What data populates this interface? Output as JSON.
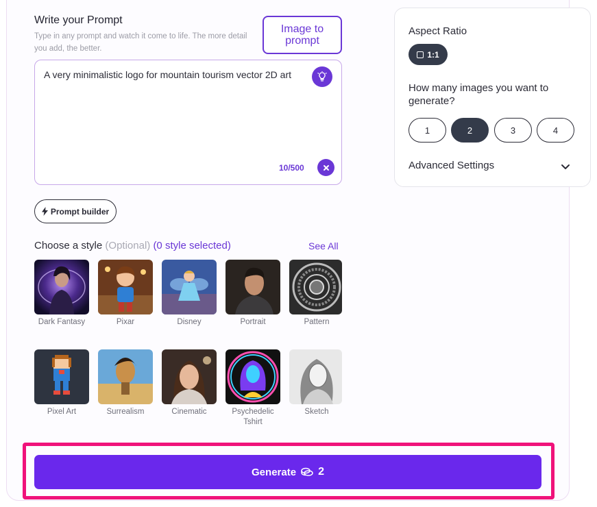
{
  "prompt": {
    "title": "Write your Prompt",
    "subtitle": "Type in any prompt and watch it come to life. The more detail you add, the better.",
    "image_to_prompt_label": "Image to prompt",
    "value": "A very minimalistic logo for mountain tourism vector 2D art",
    "char_count": "10/500",
    "builder_label": "Prompt builder"
  },
  "styles": {
    "heading": "Choose a style",
    "optional": "(Optional)",
    "selected": "(0 style selected)",
    "see_all": "See All",
    "items": [
      {
        "label": "Dark Fantasy"
      },
      {
        "label": "Pixar"
      },
      {
        "label": "Disney"
      },
      {
        "label": "Portrait"
      },
      {
        "label": "Pattern"
      },
      {
        "label": "Pixel Art"
      },
      {
        "label": "Surrealism"
      },
      {
        "label": "Cinematic"
      },
      {
        "label": "Psychedelic Tshirt"
      },
      {
        "label": "Sketch"
      }
    ]
  },
  "settings": {
    "aspect_title": "Aspect Ratio",
    "aspect_value": "1:1",
    "count_title": "How many images you want to generate?",
    "count_options": [
      "1",
      "2",
      "3",
      "4"
    ],
    "count_selected": "2",
    "advanced_label": "Advanced Settings"
  },
  "generate": {
    "label": "Generate",
    "cost": "2"
  },
  "colors": {
    "accent": "#6a37d6",
    "generate_bg": "#6a28ec",
    "highlight": "#f0127a",
    "chip_dark": "#343b4a"
  }
}
